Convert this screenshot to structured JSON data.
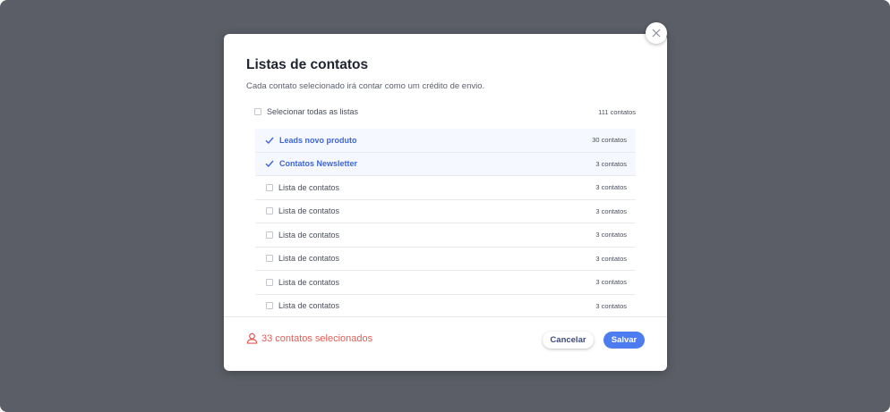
{
  "modal": {
    "title": "Listas de contatos",
    "subtitle": "Cada contato selecionado irá contar como um crédito de envio."
  },
  "select_all": {
    "label": "Selecionar todas as listas",
    "count": "111 contatos",
    "checked": false
  },
  "lists": [
    {
      "label": "Leads novo produto",
      "count": "30 contatos",
      "checked": true
    },
    {
      "label": "Contatos Newsletter",
      "count": "3 contatos",
      "checked": true
    },
    {
      "label": "Lista de contatos",
      "count": "3 contatos",
      "checked": false
    },
    {
      "label": "Lista de contatos",
      "count": "3 contatos",
      "checked": false
    },
    {
      "label": "Lista de contatos",
      "count": "3 contatos",
      "checked": false
    },
    {
      "label": "Lista de contatos",
      "count": "3 contatos",
      "checked": false
    },
    {
      "label": "Lista de contatos",
      "count": "3 contatos",
      "checked": false
    },
    {
      "label": "Lista de contatos",
      "count": "3 contatos",
      "checked": false
    }
  ],
  "footer": {
    "selected_count": "33 contatos selecionados",
    "cancel_label": "Cancelar",
    "save_label": "Salvar"
  },
  "icons": {
    "close": "close-icon",
    "check": "check-icon",
    "user": "user-icon"
  },
  "colors": {
    "backdrop": "#5b5e66",
    "accent": "#4d7cf0",
    "selected_text": "#3d66d6",
    "alert": "#e05d57"
  }
}
